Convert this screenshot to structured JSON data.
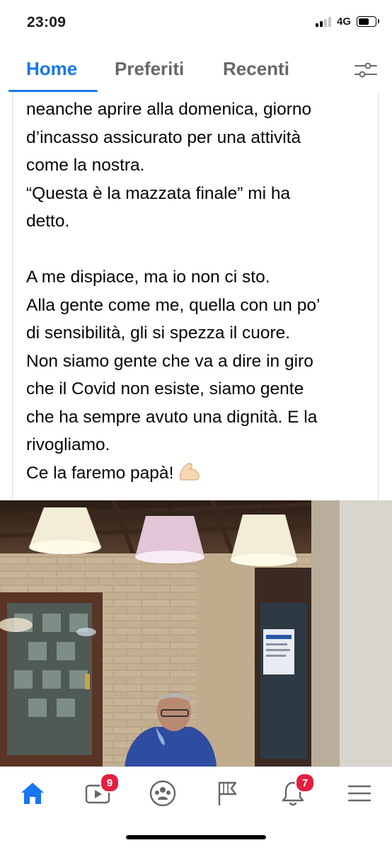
{
  "status_bar": {
    "time": "23:09",
    "network": "4G",
    "battery_level": 0.7
  },
  "tabs": [
    {
      "label": "Home",
      "active": true
    },
    {
      "label": "Preferiti",
      "active": false
    },
    {
      "label": "Recenti",
      "active": false
    }
  ],
  "header": {
    "filter_icon": "sliders-icon"
  },
  "post": {
    "lines": [
      "neanche aprire alla domenica, giorno",
      "d’incasso assicurato per una attività",
      "come la nostra.",
      "“Questa è la mazzata finale” mi ha",
      "detto.",
      "",
      "A me dispiace, ma io non ci sto.",
      "Alla gente come me, quella con un po’",
      "di sensibilità, gli si spezza il cuore.",
      "Non siamo gente che va a dire in giro",
      "che il Covid non esiste, siamo gente",
      "che ha sempre avuto una dignità. E la",
      "rivogliamo.",
      "Ce la faremo papà!"
    ],
    "emoji": "flexed-biceps-emoji"
  },
  "bottom_nav": {
    "items": [
      {
        "icon": "home-icon",
        "active": true
      },
      {
        "icon": "video-icon",
        "badge": "9"
      },
      {
        "icon": "groups-icon"
      },
      {
        "icon": "pages-flag-icon"
      },
      {
        "icon": "bell-icon",
        "badge": "7"
      },
      {
        "icon": "menu-icon"
      }
    ]
  },
  "colors": {
    "accent": "#1877f2",
    "badge": "#e41e3f",
    "inactive": "#65676b"
  }
}
